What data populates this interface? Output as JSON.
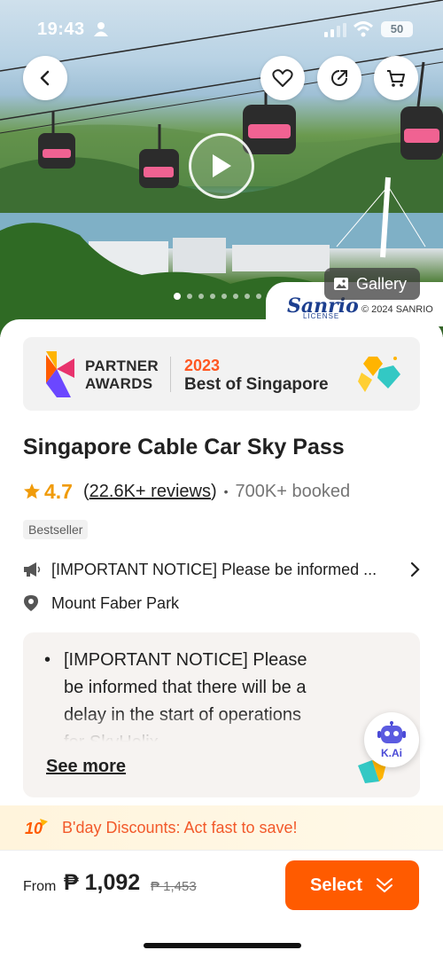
{
  "status_bar": {
    "time": "19:43",
    "battery": "50"
  },
  "hero": {
    "gallery_label": "Gallery",
    "watermark_brand": "Sanrio",
    "watermark_license": "LICENSE",
    "copyright": "© 2024 SANRIO",
    "carousel": {
      "total": 8,
      "active_index": 0
    }
  },
  "awards": {
    "partner_line1": "PARTNER",
    "partner_line2": "AWARDS",
    "year": "2023",
    "title": "Best of Singapore"
  },
  "product": {
    "title": "Singapore Cable Car Sky Pass",
    "rating": "4.7",
    "reviews": "22.6K+ reviews",
    "booked": "700K+ booked",
    "badge": "Bestseller",
    "notice_short": "[IMPORTANT NOTICE] Please be informed ...",
    "location": "Mount Faber Park"
  },
  "notice_box": {
    "text": "[IMPORTANT NOTICE] Please be informed that there will be a delay in the start of operations for SkyHelix",
    "see_more": "See more"
  },
  "assistant": {
    "label": "K.Ai"
  },
  "promo": {
    "text": "B'day Discounts: Act fast to save!"
  },
  "bottom_bar": {
    "from_label": "From",
    "price": "₱ 1,092",
    "old_price": "₱ 1,453",
    "select_label": "Select"
  },
  "colors": {
    "accent": "#ff5b00",
    "rating_star": "#f09b0a",
    "promo_text": "#f2592a"
  }
}
